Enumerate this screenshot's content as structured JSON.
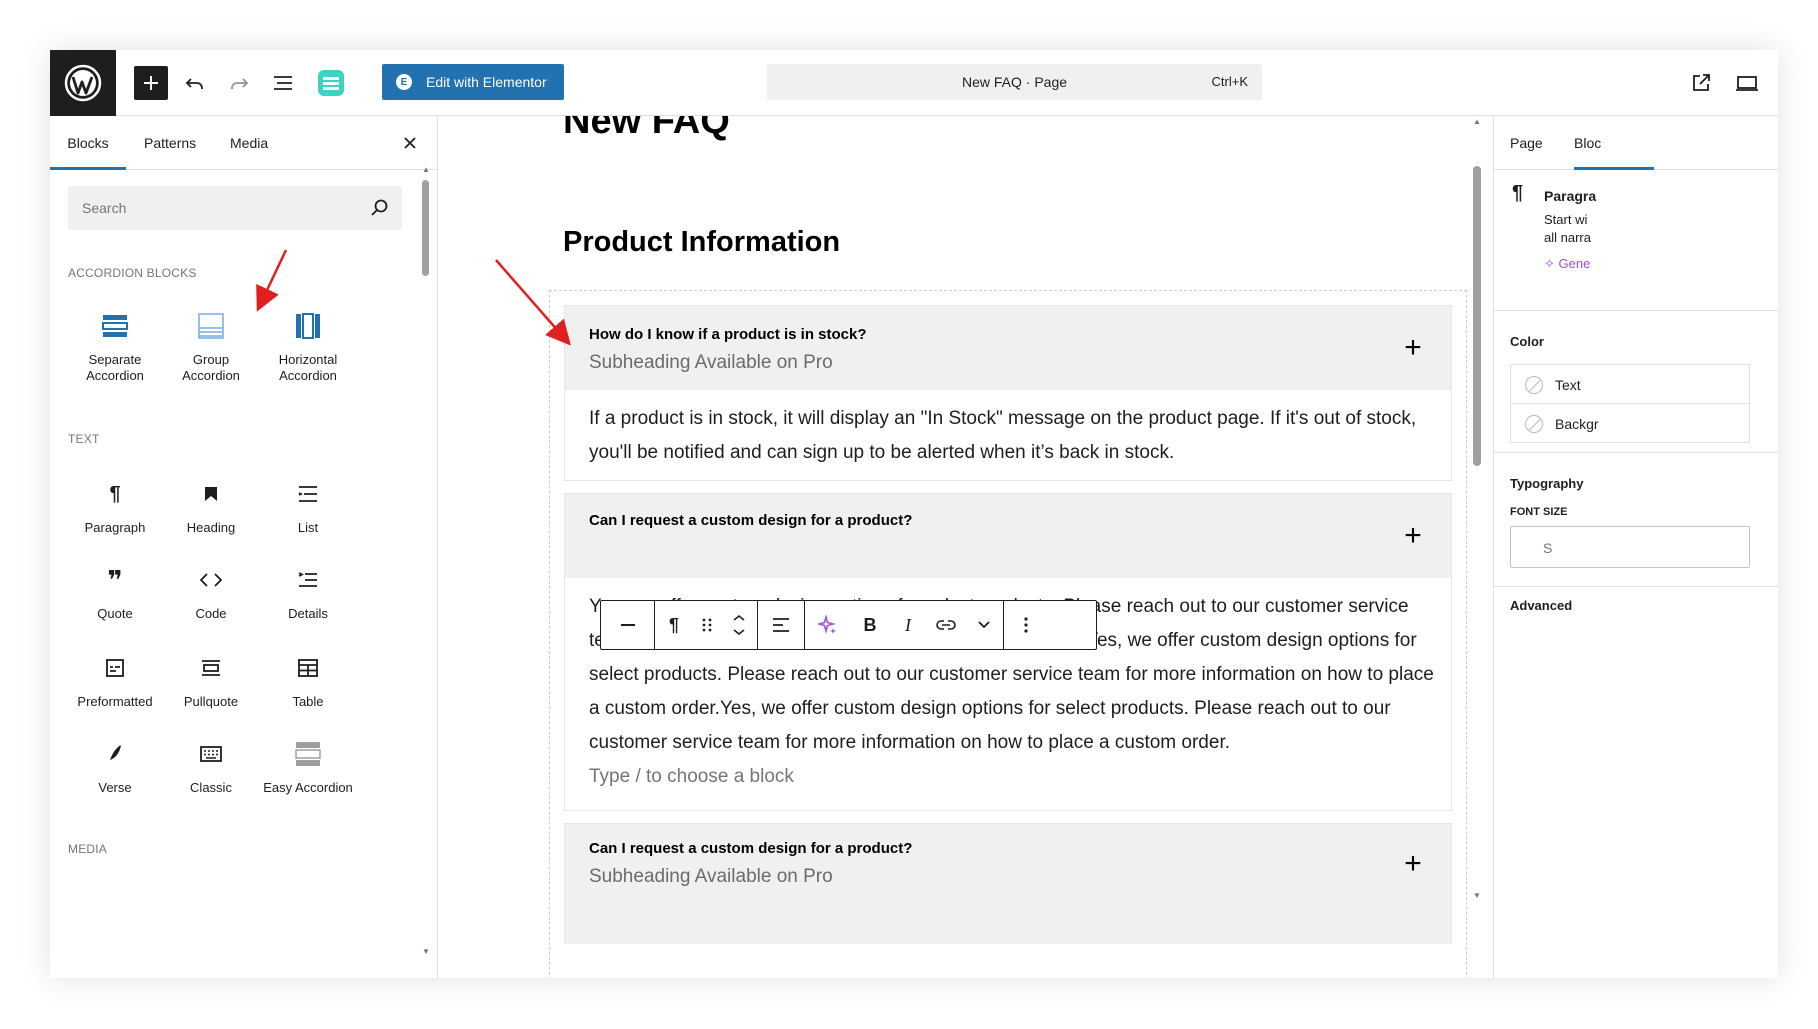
{
  "topbar": {
    "add_icon": "plus-icon",
    "undo_icon": "undo-icon",
    "redo_icon": "redo-icon",
    "list_view_icon": "list-view-icon",
    "elementor_label": "Edit with Elementor",
    "elementor_badge": "E",
    "document_title": "New FAQ · Page",
    "command_shortcut": "Ctrl+K"
  },
  "inserter": {
    "tabs": [
      "Blocks",
      "Patterns",
      "Media"
    ],
    "search_placeholder": "Search",
    "sections": {
      "accordion": "ACCORDION BLOCKS",
      "text": "TEXT",
      "media": "MEDIA"
    },
    "accordion_blocks": [
      {
        "label": "Separate Accordion",
        "icon": "separate-accordion-icon"
      },
      {
        "label": "Group Accordion",
        "icon": "group-accordion-icon"
      },
      {
        "label": "Horizontal Accordion",
        "icon": "horizontal-accordion-icon"
      }
    ],
    "text_blocks": [
      {
        "label": "Paragraph",
        "icon": "paragraph-icon"
      },
      {
        "label": "Heading",
        "icon": "heading-icon"
      },
      {
        "label": "List",
        "icon": "list-icon"
      },
      {
        "label": "Quote",
        "icon": "quote-icon"
      },
      {
        "label": "Code",
        "icon": "code-icon"
      },
      {
        "label": "Details",
        "icon": "details-icon"
      },
      {
        "label": "Preformatted",
        "icon": "preformatted-icon"
      },
      {
        "label": "Pullquote",
        "icon": "pullquote-icon"
      },
      {
        "label": "Table",
        "icon": "table-icon"
      },
      {
        "label": "Verse",
        "icon": "verse-icon"
      },
      {
        "label": "Classic",
        "icon": "classic-icon"
      },
      {
        "label": "Easy Accordion",
        "icon": "easy-accordion-icon"
      }
    ]
  },
  "canvas": {
    "page_title": "New FAQ",
    "section_heading": "Product Information",
    "accordions": [
      {
        "question": "How do I know if a product is in stock?",
        "subheading": "Subheading Available on Pro",
        "answer": "If a product is in stock, it will display an \"In Stock\" message on the product page. If it's out of stock, you'll be notified and can sign up to be alerted when it’s back in stock."
      },
      {
        "question": "Can I request a custom design for a product?",
        "answer": "Yes, we offer custom design options for select products. Please reach out to our customer service team for more information on how to place a custom order. Yes, we offer custom design options for select products. Please reach out to our customer service team for more information on how to place a custom order.Yes, we offer custom design options for select products. Please reach out to our customer service team for more information on how to place a custom order.",
        "placeholder": "Type / to choose a block"
      },
      {
        "question": "Can I request a custom design for a product?",
        "subheading": "Subheading Available on Pro"
      }
    ]
  },
  "settings": {
    "tabs": [
      "Page",
      "Bloc"
    ],
    "block_name": "Paragra",
    "block_desc_line1": "Start wi",
    "block_desc_line2": "all narra",
    "generate_label": "Gene",
    "color_title": "Color",
    "color_text": "Text",
    "color_background": "Backgr",
    "typography_title": "Typography",
    "font_size_label": "FONT SIZE",
    "font_size_value": "S",
    "advanced_title": "Advanced",
    "accent_color": "#2271b1",
    "ai_color": "#9b51e0"
  }
}
